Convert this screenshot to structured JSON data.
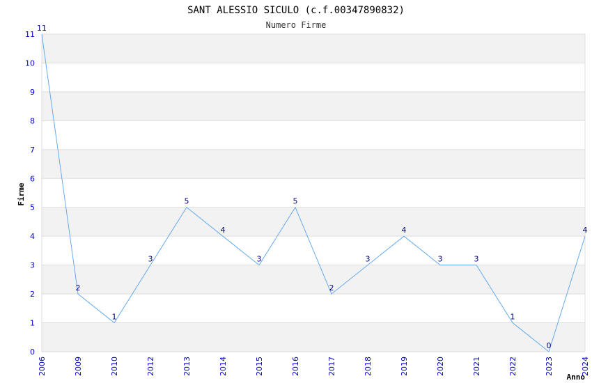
{
  "chart_data": {
    "type": "line",
    "title": "SANT ALESSIO SICULO (c.f.00347890832)",
    "subtitle": "Numero Firme",
    "xlabel": "Anno",
    "ylabel": "Firme",
    "categories": [
      "2006",
      "2009",
      "2010",
      "2012",
      "2013",
      "2014",
      "2015",
      "2016",
      "2017",
      "2018",
      "2019",
      "2020",
      "2021",
      "2022",
      "2023",
      "2024"
    ],
    "values": [
      11,
      2,
      1,
      3,
      5,
      4,
      3,
      5,
      2,
      3,
      4,
      3,
      3,
      1,
      0,
      4
    ],
    "ylim": [
      0,
      11
    ],
    "yticks": [
      "0",
      "1",
      "2",
      "3",
      "4",
      "5",
      "6",
      "7",
      "8",
      "9",
      "10",
      "11"
    ],
    "grid": true,
    "band_color": "#f2f2f2",
    "grid_color": "#dddddd",
    "line_color": "#66aaee",
    "tick_color": "#0000cc",
    "label_color": "#000080"
  }
}
